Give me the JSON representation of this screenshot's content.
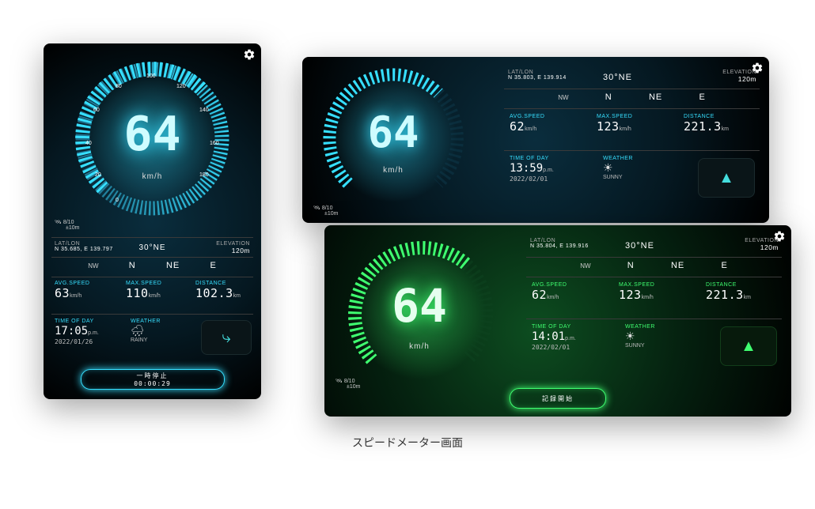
{
  "caption": "スピードメーター画面",
  "A": {
    "speed": "64",
    "unit": "km/h",
    "ticks": [
      "0",
      "20",
      "40",
      "60",
      "80",
      "100",
      "120",
      "140",
      "160",
      "180"
    ],
    "satFix": "8/10",
    "satAcc": "±10m",
    "latlonLabel": "LAT/LON",
    "latlon": "N 35.685, E 139.797",
    "compassMain": "30°NE",
    "compassLabels": [
      "NW",
      "N",
      "NE",
      "E"
    ],
    "elevationLabel": "ELEVATION",
    "elevation": "120m",
    "avgLabel": "AVG.SPEED",
    "avg": "63",
    "avgU": "km/h",
    "maxLabel": "MAX.SPEED",
    "max": "110",
    "maxU": "km/h",
    "distLabel": "DISTANCE",
    "dist": "102.3",
    "distU": "km",
    "todLabel": "TIME OF DAY",
    "time": "17:05",
    "ampm": "p.m.",
    "date": "2022/01/26",
    "weatherLabel": "WEATHER",
    "weather": "RAINY",
    "btnLine1": "一時停止",
    "btnLine2": "00:00:29"
  },
  "B": {
    "speed": "64",
    "unit": "km/h",
    "satFix": "8/10",
    "satAcc": "±10m",
    "latlonLabel": "LAT/LON",
    "latlon": "N 35.803, E 139.914",
    "compassMain": "30°NE",
    "compassLabels": [
      "NW",
      "N",
      "NE",
      "E"
    ],
    "elevationLabel": "ELEVATION",
    "elevation": "120m",
    "avgLabel": "AVG.SPEED",
    "avg": "62",
    "avgU": "km/h",
    "maxLabel": "MAX.SPEED",
    "max": "123",
    "maxU": "km/h",
    "distLabel": "DISTANCE",
    "dist": "221.3",
    "distU": "km",
    "todLabel": "TIME OF DAY",
    "time": "13:59",
    "ampm": "p.m.",
    "date": "2022/02/01",
    "weatherLabel": "WEATHER",
    "weather": "SUNNY"
  },
  "C": {
    "speed": "64",
    "unit": "km/h",
    "satFix": "8/10",
    "satAcc": "±10m",
    "latlonLabel": "LAT/LON",
    "latlon": "N 35.804, E 139.916",
    "compassMain": "30°NE",
    "compassLabels": [
      "NW",
      "N",
      "NE",
      "E"
    ],
    "elevationLabel": "ELEVATION",
    "elevation": "120m",
    "avgLabel": "AVG.SPEED",
    "avg": "62",
    "avgU": "km/h",
    "maxLabel": "MAX.SPEED",
    "max": "123",
    "maxU": "km/h",
    "distLabel": "DISTANCE",
    "dist": "221.3",
    "distU": "km",
    "todLabel": "TIME OF DAY",
    "time": "14:01",
    "ampm": "p.m.",
    "date": "2022/02/01",
    "weatherLabel": "WEATHER",
    "weather": "SUNNY",
    "btn": "記録開始"
  }
}
